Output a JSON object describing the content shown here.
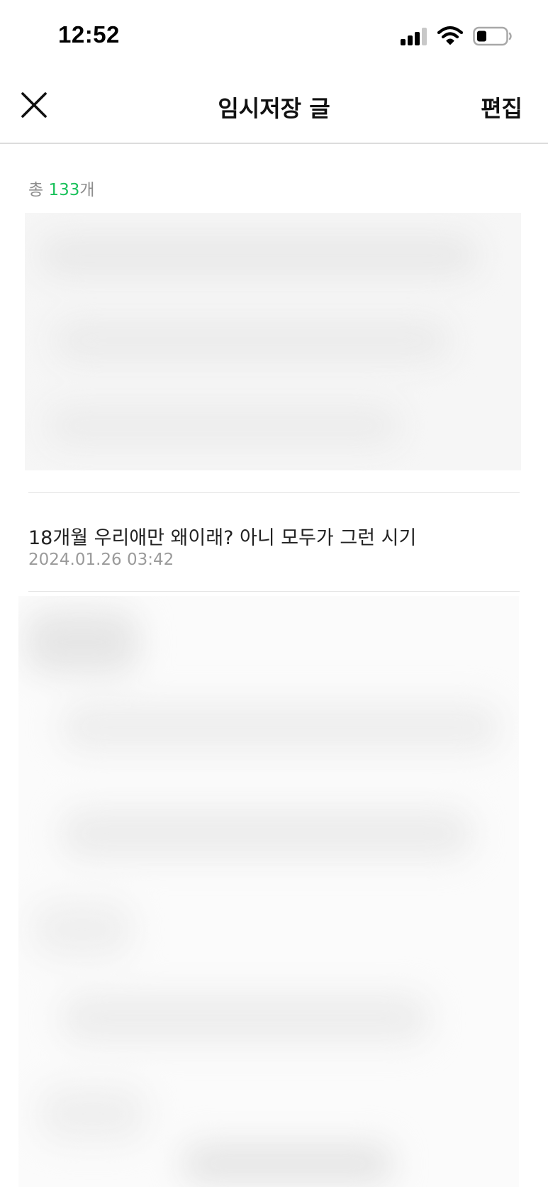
{
  "status_bar": {
    "time": "12:52",
    "icons": [
      "signal-icon",
      "wifi-icon",
      "battery-icon"
    ]
  },
  "nav": {
    "title": "임시저장 글",
    "edit_label": "편집",
    "close_icon": "close-icon"
  },
  "summary": {
    "prefix": "총 ",
    "count": "133",
    "suffix": "개"
  },
  "drafts": [
    {
      "title": "18개월 우리애만 왜이래? 아니 모두가 그런 시기",
      "date": "2024.01.26 03:42"
    }
  ],
  "colors": {
    "accent": "#19c15a",
    "text_primary": "#111111",
    "text_secondary": "#9a9a9a",
    "divider": "#e4e4e4"
  }
}
